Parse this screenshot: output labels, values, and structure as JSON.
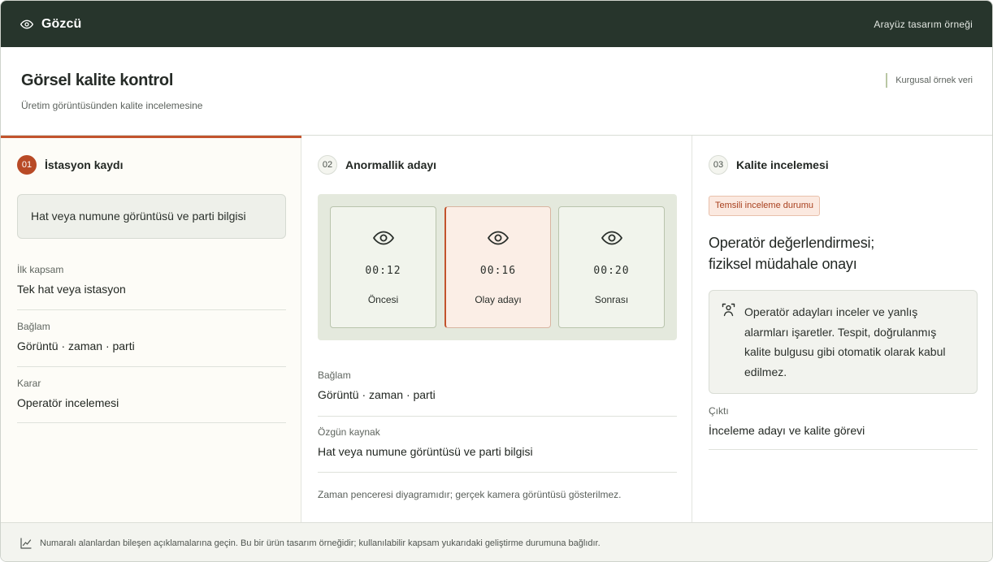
{
  "topbar": {
    "brand": "Gözcü",
    "right_label": "Arayüz tasarım örneği"
  },
  "header": {
    "title": "Görsel kalite kontrol",
    "subtitle": "Üretim görüntüsünden kalite incelemesine",
    "note": "Kurgusal örnek veri"
  },
  "step1": {
    "number": "01",
    "title": "İstasyon kaydı",
    "source": "Hat veya numune görüntüsü ve parti bilgisi",
    "fields": [
      {
        "label": "İlk kapsam",
        "value": "Tek hat veya istasyon"
      },
      {
        "label": "Bağlam",
        "value": "Görüntü · zaman · parti"
      },
      {
        "label": "Karar",
        "value": "Operatör incelemesi"
      }
    ]
  },
  "step2": {
    "number": "02",
    "title": "Anormallik adayı",
    "frames": [
      {
        "time": "00:12",
        "label": "Öncesi"
      },
      {
        "time": "00:16",
        "label": "Olay adayı"
      },
      {
        "time": "00:20",
        "label": "Sonrası"
      }
    ],
    "fields": [
      {
        "label": "Bağlam",
        "value": "Görüntü · zaman · parti"
      },
      {
        "label": "Özgün kaynak",
        "value": "Hat veya numune görüntüsü ve parti bilgisi"
      }
    ],
    "note": "Zaman penceresi diyagramıdır; gerçek kamera görüntüsü gösterilmez."
  },
  "step3": {
    "number": "03",
    "title": "Kalite incelemesi",
    "badge": "Temsili inceleme durumu",
    "review_title_line1": "Operatör değerlendirmesi;",
    "review_title_line2": "fiziksel müdahale onayı",
    "review_text": "Operatör adayları inceler ve yanlış alarmları işaretler. Tespit, doğrulanmış kalite bulgusu gibi otomatik olarak kabul edilmez.",
    "fields": [
      {
        "label": "Çıktı",
        "value": "İnceleme adayı ve kalite görevi"
      }
    ]
  },
  "footer": {
    "text": "Numaralı alanlardan bileşen açıklamalarına geçin. Bu bir ürün tasarım örneğidir; kullanılabilir kapsam yukarıdaki geliştirme durumuna bağlıdır."
  },
  "colors": {
    "topbar": "#27352c",
    "accent": "#c2532d",
    "timeline_bg": "#e4e9dd"
  },
  "icons": {
    "brand": "eye-icon",
    "frame": "eye-icon",
    "reviewer": "person-icon",
    "footer": "chart-line-icon"
  }
}
